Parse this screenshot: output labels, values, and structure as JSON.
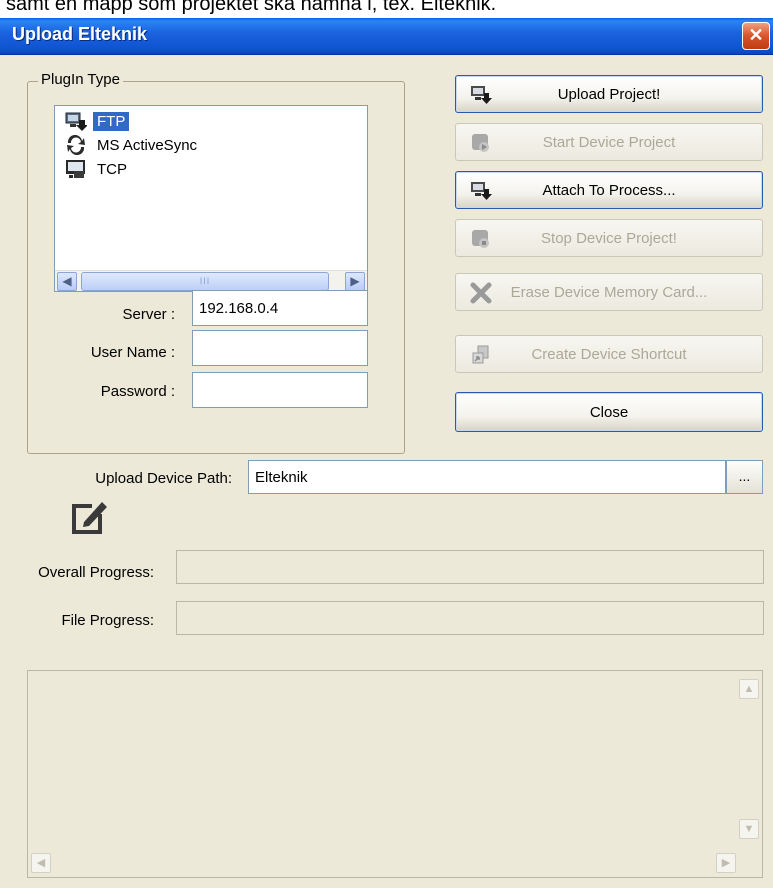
{
  "background_caption": "samt en mapp som projektet ska hamna i, tex. Elteknik.",
  "window": {
    "title": "Upload Elteknik",
    "close_glyph": "✕"
  },
  "plugin_group": {
    "legend": "PlugIn Type",
    "items": [
      {
        "label": "FTP",
        "icon": "ftp-computer-icon",
        "selected": true
      },
      {
        "label": "MS ActiveSync",
        "icon": "activesync-arrows-icon",
        "selected": false
      },
      {
        "label": "TCP",
        "icon": "tcp-computer-icon",
        "selected": false
      }
    ],
    "scroll_grip": "III",
    "server_label": "Server :",
    "server_value": "192.168.0.4",
    "username_label": "User Name :",
    "username_value": "",
    "password_label": "Password :",
    "password_value": ""
  },
  "buttons": [
    {
      "label": "Upload Project!",
      "enabled": true,
      "icon": "upload-computer-icon"
    },
    {
      "label": "Start Device Project",
      "enabled": false,
      "icon": "start-device-icon"
    },
    {
      "label": "Attach To Process...",
      "enabled": true,
      "icon": "attach-computer-icon"
    },
    {
      "label": "Stop Device Project!",
      "enabled": false,
      "icon": "stop-device-icon"
    },
    {
      "label": "Erase Device Memory Card...",
      "enabled": false,
      "icon": "erase-x-icon"
    },
    {
      "label": "Create Device Shortcut",
      "enabled": false,
      "icon": "shortcut-icon"
    },
    {
      "label": "Close",
      "enabled": true,
      "icon": ""
    }
  ],
  "upload_path": {
    "label": "Upload Device Path:",
    "value": "Elteknik",
    "browse_label": "..."
  },
  "edit_icon": "edit-pencil-icon",
  "overall_progress": {
    "label": "Overall Progress:",
    "value": 0
  },
  "file_progress": {
    "label": "File Progress:",
    "value": 0
  },
  "output_log": {
    "text": ""
  }
}
